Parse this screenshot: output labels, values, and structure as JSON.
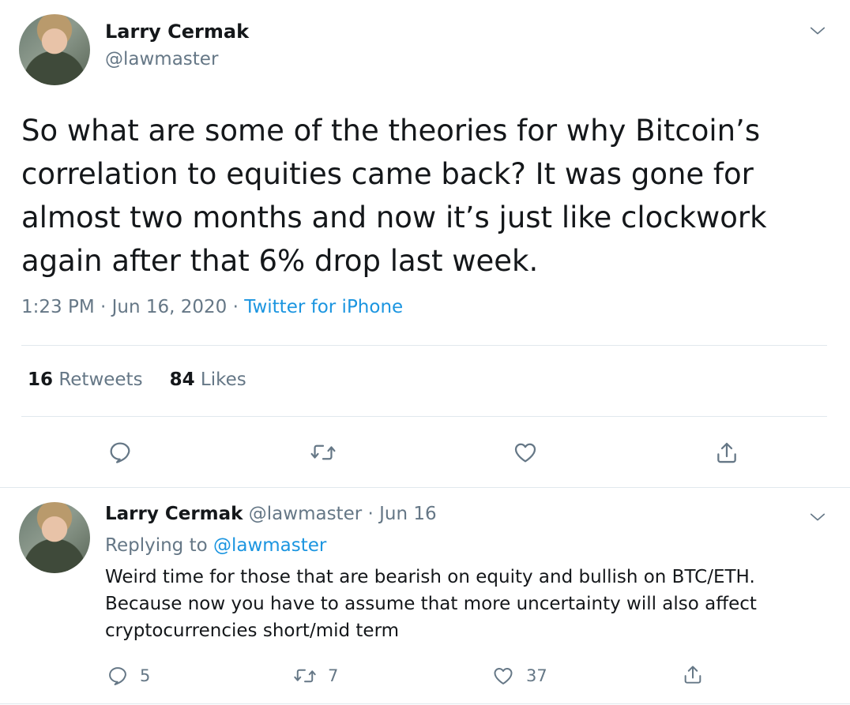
{
  "main_tweet": {
    "author_name": "Larry Cermak",
    "author_handle": "@lawmaster",
    "text": "So what are some of the theories for why Bitcoin’s correlation to equities came back? It was gone for almost two months and now it’s just like clockwork again after that 6% drop last week.",
    "timestamp": "1:23 PM · Jun 16, 2020 · ",
    "source": "Twitter for iPhone",
    "retweets_count": "16",
    "retweets_label": "Retweets",
    "likes_count": "84",
    "likes_label": "Likes"
  },
  "reply_tweet": {
    "author_name": "Larry Cermak",
    "author_handle_date": " @lawmaster · Jun 16",
    "replying_prefix": "Replying to ",
    "replying_to": "@lawmaster",
    "text": "Weird time for those that are bearish on equity and bullish on BTC/ETH. Because now you have to assume that more uncertainty will also affect cryptocurrencies short/mid term",
    "reply_count": "5",
    "retweet_count": "7",
    "like_count": "37"
  },
  "icons": {
    "reply": "reply-icon",
    "retweet": "retweet-icon",
    "like": "heart-icon",
    "share": "share-icon",
    "more": "chevron-down-icon"
  },
  "colors": {
    "text": "#14171a",
    "secondary": "#657786",
    "link": "#1b95e0",
    "divider": "#e1e8ed"
  }
}
